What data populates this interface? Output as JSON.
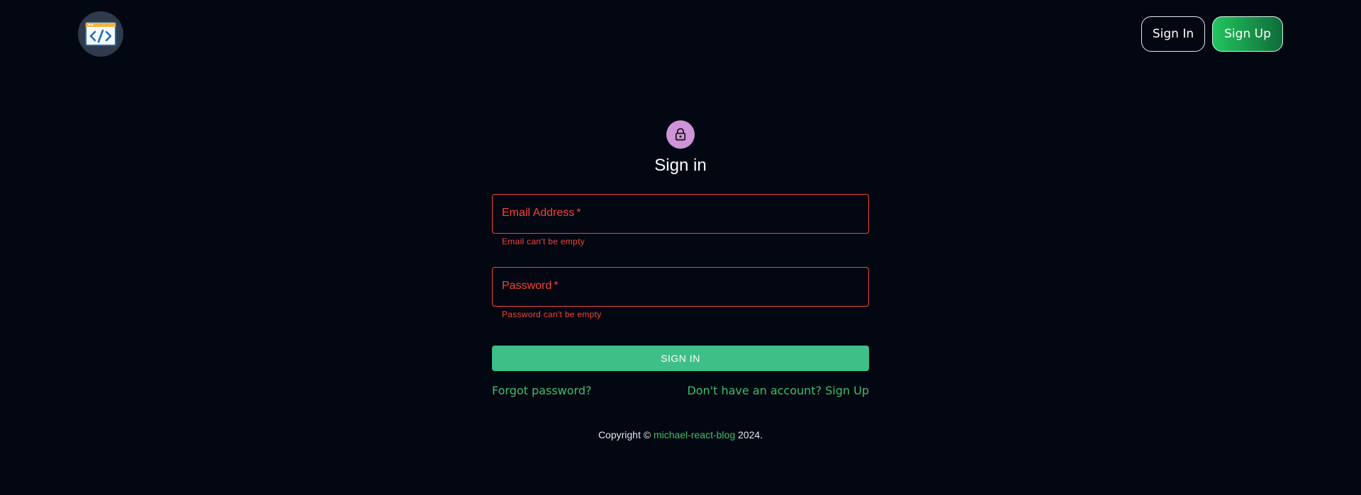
{
  "header": {
    "logo_icon": "code-window-icon",
    "signin_label": "Sign In",
    "signup_label": "Sign Up"
  },
  "form": {
    "icon": "lock-icon",
    "title": "Sign in",
    "email": {
      "label": "Email Address",
      "required_mark": "*",
      "value": "",
      "error": "Email can't be empty"
    },
    "password": {
      "label": "Password",
      "required_mark": "*",
      "value": "",
      "error": "Password can't be empty"
    },
    "submit_label": "SIGN IN",
    "forgot_label": "Forgot password?",
    "signup_link_label": "Don't have an account? Sign Up"
  },
  "footer": {
    "prefix": "Copyright ©",
    "brand": "michael-react-blog",
    "suffix": "2024."
  },
  "colors": {
    "background": "#030712",
    "accent": "#3fbf88",
    "error": "#f44336",
    "lock_badge": "#ce93d8"
  }
}
